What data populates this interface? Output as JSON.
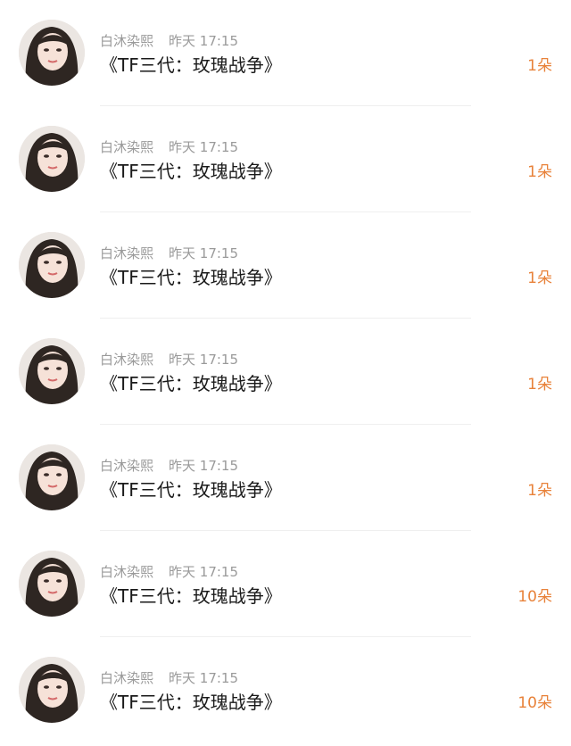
{
  "gifts": [
    {
      "user": "白沐染熙",
      "time": "昨天 17:15",
      "title": "《TF三代：玫瑰战争》",
      "amount": "1朵"
    },
    {
      "user": "白沐染熙",
      "time": "昨天 17:15",
      "title": "《TF三代：玫瑰战争》",
      "amount": "1朵"
    },
    {
      "user": "白沐染熙",
      "time": "昨天 17:15",
      "title": "《TF三代：玫瑰战争》",
      "amount": "1朵"
    },
    {
      "user": "白沐染熙",
      "time": "昨天 17:15",
      "title": "《TF三代：玫瑰战争》",
      "amount": "1朵"
    },
    {
      "user": "白沐染熙",
      "time": "昨天 17:15",
      "title": "《TF三代：玫瑰战争》",
      "amount": "1朵"
    },
    {
      "user": "白沐染熙",
      "time": "昨天 17:15",
      "title": "《TF三代：玫瑰战争》",
      "amount": "10朵"
    },
    {
      "user": "白沐染熙",
      "time": "昨天 17:15",
      "title": "《TF三代：玫瑰战争》",
      "amount": "10朵"
    }
  ]
}
